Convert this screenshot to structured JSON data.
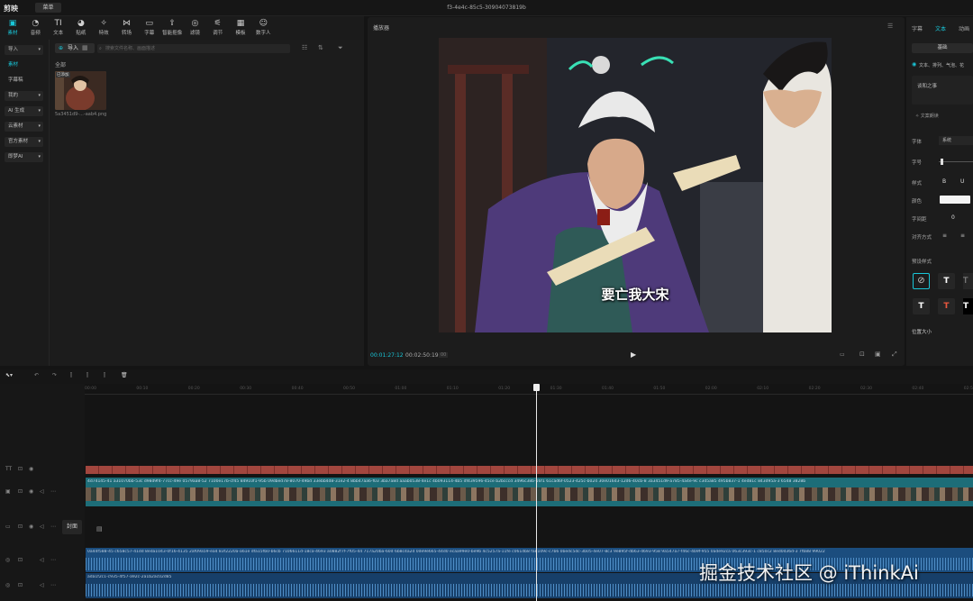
{
  "app": {
    "logo": "剪映",
    "menu_label": "菜单",
    "project_title": "f3-4e4c-85c5-30904073819b"
  },
  "toolbar": [
    {
      "icon": "media-icon",
      "glyph": "▣",
      "label": "素材"
    },
    {
      "icon": "audio-icon",
      "glyph": "◔",
      "label": "音频"
    },
    {
      "icon": "text-icon",
      "glyph": "TI",
      "label": "文本"
    },
    {
      "icon": "sticker-icon",
      "glyph": "◕",
      "label": "贴纸"
    },
    {
      "icon": "effects-icon",
      "glyph": "✧",
      "label": "特效"
    },
    {
      "icon": "transition-icon",
      "glyph": "⋈",
      "label": "转场"
    },
    {
      "icon": "caption-icon",
      "glyph": "▭",
      "label": "字幕"
    },
    {
      "icon": "filter-icon",
      "glyph": "⇪",
      "label": "智能抠像"
    },
    {
      "icon": "adjust-icon",
      "glyph": "◎",
      "label": "滤镜"
    },
    {
      "icon": "tune-icon",
      "glyph": "⚟",
      "label": "调节"
    },
    {
      "icon": "template-icon",
      "glyph": "▦",
      "label": "模板"
    },
    {
      "icon": "avatar-icon",
      "glyph": "☺",
      "label": "数字人"
    }
  ],
  "left_categories": [
    {
      "label": "导入",
      "box": true,
      "chevron": true,
      "selected": false
    },
    {
      "label": "素材",
      "box": false,
      "chevron": false,
      "selected": true
    },
    {
      "label": "字幕稿",
      "box": false,
      "chevron": false,
      "selected": false
    },
    {
      "label": "我的",
      "box": true,
      "chevron": true,
      "selected": false
    },
    {
      "label": "AI 生成",
      "box": true,
      "chevron": true,
      "selected": false
    },
    {
      "label": "云素材",
      "box": true,
      "chevron": true,
      "selected": false
    },
    {
      "label": "官方素材",
      "box": true,
      "chevron": true,
      "selected": false
    },
    {
      "label": "即梦AI",
      "box": true,
      "chevron": true,
      "selected": false
    }
  ],
  "media": {
    "import_label": "导入",
    "search_placeholder": "搜索文件名称、画面描述",
    "all_label": "全部",
    "thumb_badge": "已添加",
    "thumb_name": "5a3451d9-...-aab4.png"
  },
  "player": {
    "title": "播放器",
    "subtitle": "要亡我大宋",
    "current_time": "00:01:27:12",
    "total_time": "00:02:50:19"
  },
  "right_panel": {
    "tabs": [
      "字幕",
      "文本",
      "动画"
    ],
    "basic_tab": "基础",
    "checkbox_label": "文本、排列、气泡、花",
    "text_value": "谈和之事",
    "labels": [
      "字体",
      "字号",
      "样式",
      "颜色",
      "字间距",
      "对齐方式"
    ],
    "font_value": "系统",
    "spacing_value": "0",
    "preset_label": "预设样式",
    "position_label": "位置大小"
  },
  "timeline": {
    "ticks": [
      "00:00",
      "00:10",
      "00:20",
      "00:30",
      "00:40",
      "00:50",
      "01:00",
      "01:10",
      "01:20",
      "01:30",
      "01:40",
      "01:50",
      "02:00",
      "02:10",
      "02:20",
      "02:30",
      "02:40",
      "02:50"
    ],
    "cover_label": "封面",
    "video_clip_label": "4d74145-41  a31070bb-53c  d98d9f4-77cc-49e  0579aa8-52  7100e17b-cf45  84910f1-95b  09dbed78-8070-49bd  33ebb4d8-31e2-4  8bb47aa6-f03  3ba7a8d  aaab0538-4e1c  4b093114-4b5  df439596-45ce  b2bcccd  3496c38b-16f1  61cad6f-0523-425c-b024  30e016d3-12d6-40cb-8  3a3451d9-a785-4a4e-9c  c3d5a85  495b837-1  4ed81c  843d95a-3  6548  3828b",
    "audio1_label": "0a44f588-45  c658c57-41dd  8eda1043-0f16-4135  2af09a59-ea4  83f2220a-a61e  dfa15fb0-b6cb  7106611d-18ca-4693  a0882f7f-7f05-44  717a20ba-60d  6b8c4a2d  0de9e665-44d0  ecaa99e0-be9b  4c5257a-11fe  c061db8  fa8109c-c7b6  0bedc5dc-3b05-4e07-8c3  9e895f-db63-4693-958  9a547a7-f46c-4b9f-955  0ade92ca  063c393c-1  c850c2  8ed0d36d-3  7fb88  99022",
    "audio2_label": "ada1f2c1-c935-4f57-a92c-2a1b2ac02d85"
  },
  "watermark": "掘金技术社区 @ iThinkAi",
  "colors": {
    "accent": "#19c6d8",
    "text_track": "#a2463e",
    "video_track": "#1d6d78",
    "audio_track": "#1b4d7e"
  }
}
